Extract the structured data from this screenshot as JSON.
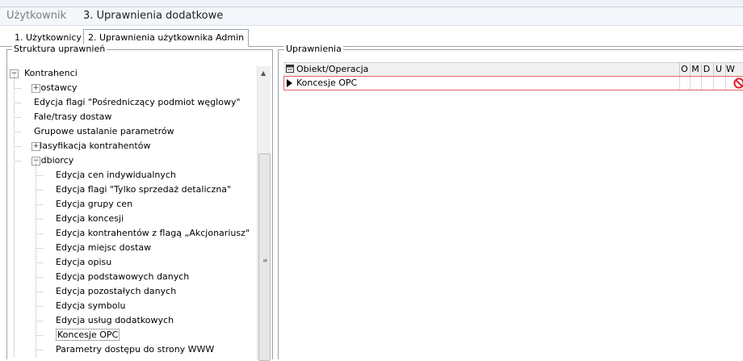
{
  "window": {
    "user_label": "Użytkownik",
    "title": "3. Uprawnienia dodatkowe"
  },
  "tabs": [
    {
      "label": "1. Użytkownicy"
    },
    {
      "label": "2. Uprawnienia użytkownika Admin"
    }
  ],
  "left_panel": {
    "title": "Struktura uprawnień",
    "tree": [
      {
        "label": "Kontrahenci",
        "level": 0,
        "expander": "minus"
      },
      {
        "label": "Dostawcy",
        "level": 1,
        "expander": "plus"
      },
      {
        "label": "Edycja flagi \"Pośredniczący podmiot węglowy\"",
        "level": 1
      },
      {
        "label": "Fale/trasy dostaw",
        "level": 1
      },
      {
        "label": "Grupowe ustalanie parametrów",
        "level": 1
      },
      {
        "label": "Klasyfikacja kontrahentów",
        "level": 1,
        "expander": "plus"
      },
      {
        "label": "Odbiorcy",
        "level": 1,
        "expander": "minus"
      },
      {
        "label": "Edycja cen indywidualnych",
        "level": 2
      },
      {
        "label": "Edycja flagi \"Tylko sprzedaż detaliczna\"",
        "level": 2
      },
      {
        "label": "Edycja grupy cen",
        "level": 2
      },
      {
        "label": "Edycja koncesji",
        "level": 2
      },
      {
        "label": "Edycja kontrahentów z flagą „Akcjonariusz\"",
        "level": 2
      },
      {
        "label": "Edycja miejsc dostaw",
        "level": 2
      },
      {
        "label": "Edycja opisu",
        "level": 2
      },
      {
        "label": "Edycja podstawowych danych",
        "level": 2
      },
      {
        "label": "Edycja pozostałych danych",
        "level": 2
      },
      {
        "label": "Edycja symbolu",
        "level": 2
      },
      {
        "label": "Edycja usług dodatkowych",
        "level": 2
      },
      {
        "label": "Koncesje OPC",
        "level": 2,
        "selected": true
      },
      {
        "label": "Parametry dostępu do strony WWW",
        "level": 2
      }
    ]
  },
  "right_panel": {
    "title": "Uprawnienia",
    "columns": [
      "Obiekt/Operacja",
      "O",
      "M",
      "D",
      "U",
      "W"
    ],
    "rows": [
      {
        "object": "Koncesje OPC",
        "O": "",
        "M": "",
        "D": "",
        "U": "",
        "W_icon": "no-entry-icon"
      }
    ]
  },
  "colors": {
    "selection_border": "#e4626b",
    "no_icon": "#e0202a"
  }
}
